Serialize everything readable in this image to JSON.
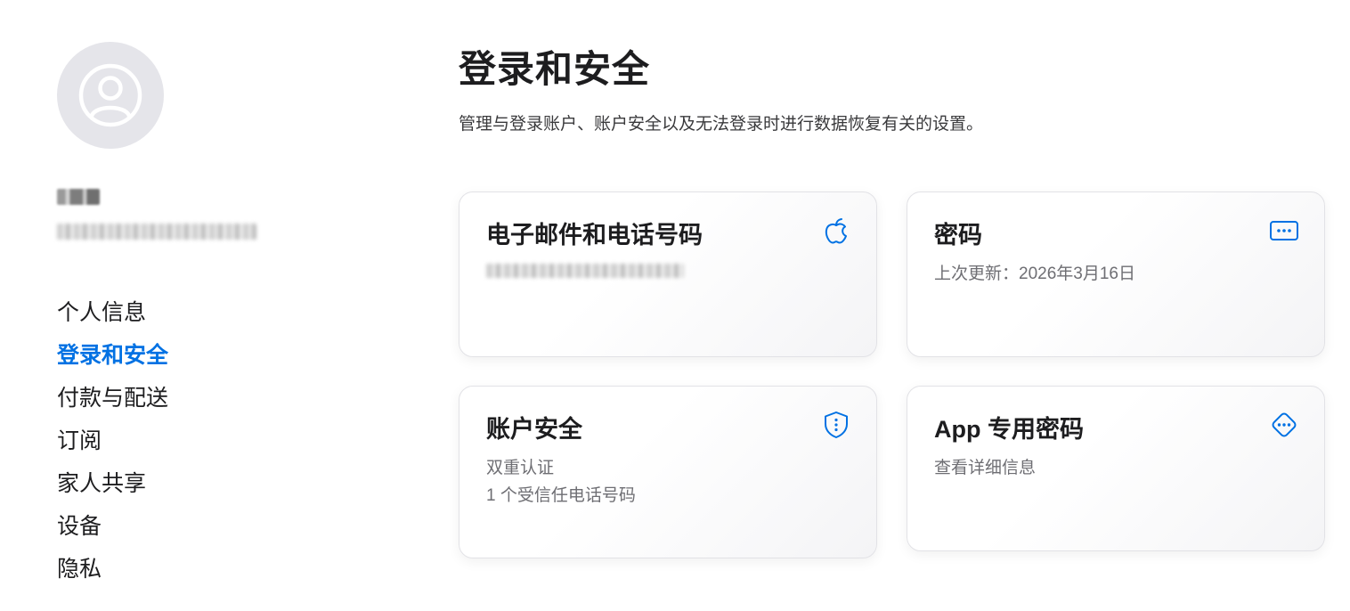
{
  "sidebar": {
    "nav_items": [
      {
        "label": "个人信息"
      },
      {
        "label": "登录和安全"
      },
      {
        "label": "付款与配送"
      },
      {
        "label": "订阅"
      },
      {
        "label": "家人共享"
      },
      {
        "label": "设备"
      },
      {
        "label": "隐私"
      }
    ],
    "active_index": 1
  },
  "main": {
    "title": "登录和安全",
    "description": "管理与登录账户、账户安全以及无法登录时进行数据恢复有关的设置。",
    "cards": {
      "email_phone": {
        "title": "电子邮件和电话号码",
        "icon": "apple-icon"
      },
      "password": {
        "title": "密码",
        "subtitle": "上次更新：2026年3月16日",
        "icon": "password-dots-icon"
      },
      "account_security": {
        "title": "账户安全",
        "line1": "双重认证",
        "line2": "1 个受信任电话号码",
        "icon": "shield-icon"
      },
      "app_passwords": {
        "title": "App 专用密码",
        "subtitle": "查看详细信息",
        "icon": "diamond-dots-icon"
      }
    }
  },
  "colors": {
    "accent": "#0071e3",
    "text": "#1d1d1f",
    "secondary_text": "#6e6e73",
    "avatar_bg": "#e5e5ea"
  }
}
